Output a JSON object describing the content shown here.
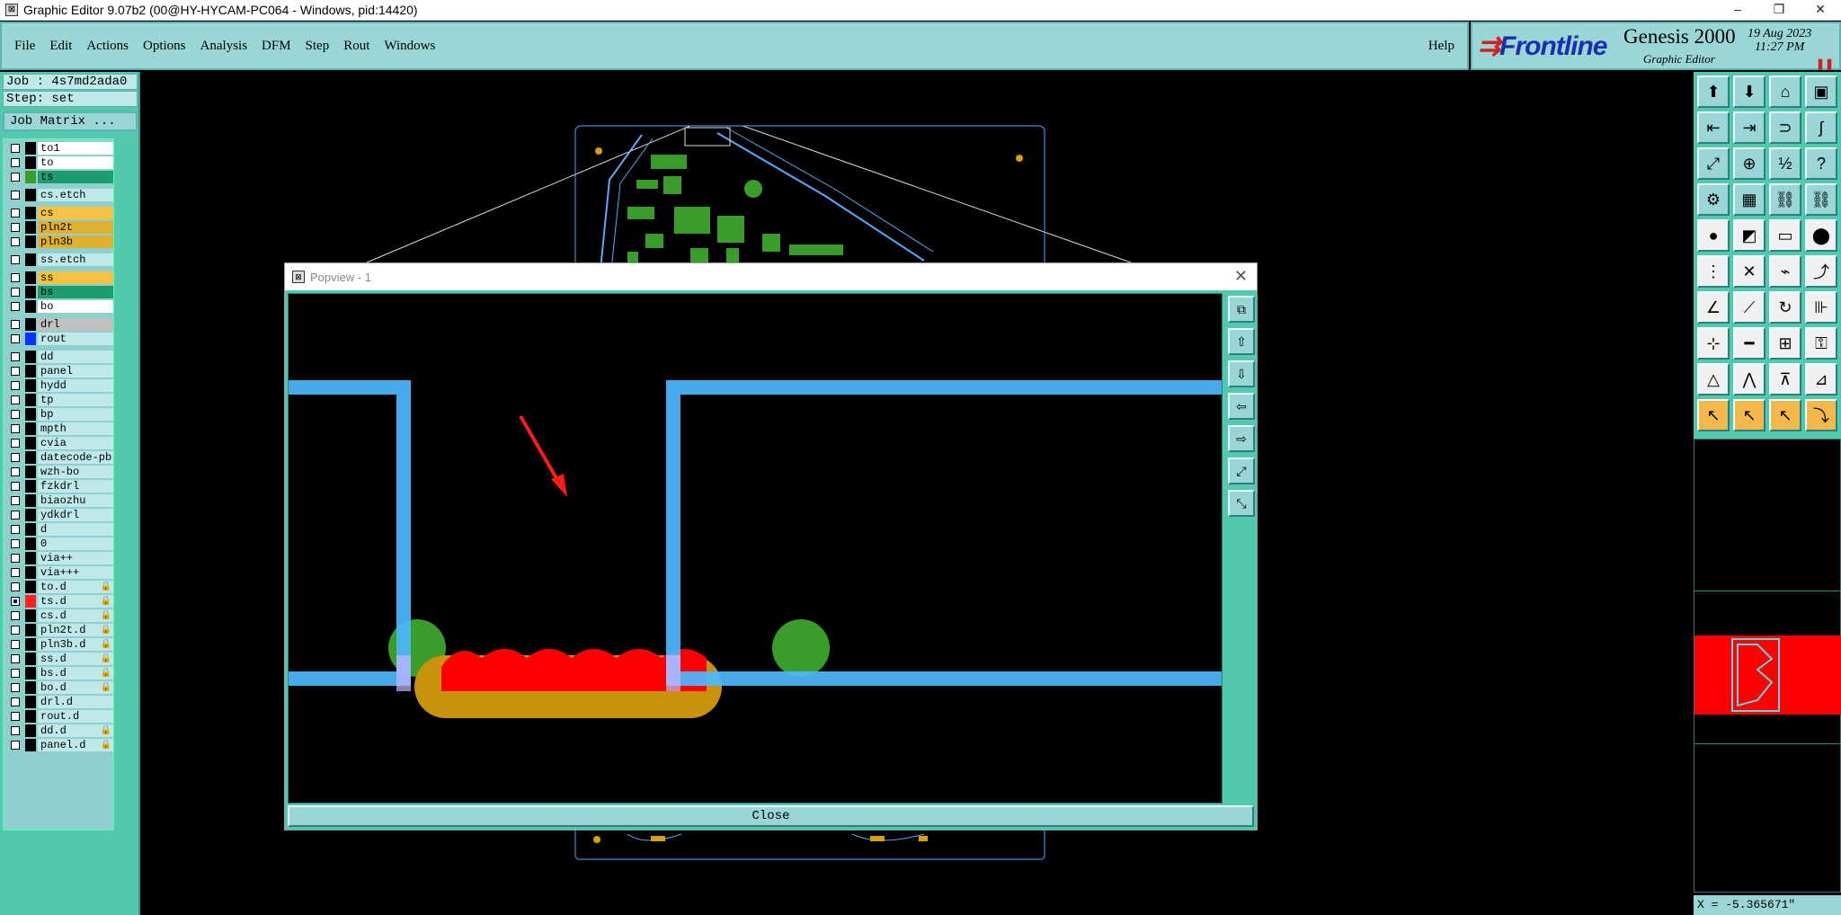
{
  "window": {
    "title": "Graphic Editor 9.07b2 (00@HY-HYCAM-PC064 - Windows, pid:14420)",
    "minimize": "–",
    "restore": "❐",
    "close": "✕"
  },
  "menu": {
    "items": [
      "File",
      "Edit",
      "Actions",
      "Options",
      "Analysis",
      "DFM",
      "Step",
      "Rout",
      "Windows"
    ],
    "help": "Help"
  },
  "brand": {
    "logo": "Frontline",
    "product": "Genesis 2000",
    "subtitle": "Graphic Editor",
    "date": "19 Aug 2023",
    "time": "11:27 PM"
  },
  "left_panel": {
    "job": "Job : 4s7md2ada0",
    "step": "Step: set",
    "job_matrix": "Job Matrix ..."
  },
  "layers": [
    {
      "name": "to1",
      "swatch": "#000000",
      "bg": "#ffffff",
      "gap": false
    },
    {
      "name": "to",
      "swatch": "#000000",
      "bg": "#ffffff",
      "gap": false
    },
    {
      "name": "ts",
      "swatch": "#3a9c2a",
      "bg": "#1c9c6f",
      "gap": false
    },
    {
      "name": "cs.etch",
      "swatch": "#000000",
      "bg": "#bfe8e8",
      "gap": true
    },
    {
      "name": "cs",
      "swatch": "#000000",
      "bg": "#f5c242",
      "gap": true
    },
    {
      "name": "pln2t",
      "swatch": "#000000",
      "bg": "#e0b030",
      "gap": false
    },
    {
      "name": "pln3b",
      "swatch": "#000000",
      "bg": "#e0b030",
      "gap": false
    },
    {
      "name": "ss.etch",
      "swatch": "#000000",
      "bg": "#bfe8e8",
      "gap": true
    },
    {
      "name": "ss",
      "swatch": "#000000",
      "bg": "#f5c242",
      "gap": true
    },
    {
      "name": "bs",
      "swatch": "#000000",
      "bg": "#1c9c6f",
      "gap": false
    },
    {
      "name": "bo",
      "swatch": "#000000",
      "bg": "#ffffff",
      "gap": false
    },
    {
      "name": "drl",
      "swatch": "#000000",
      "bg": "#c0c0c0",
      "gap": true
    },
    {
      "name": "rout",
      "swatch": "#1030ff",
      "bg": "#bfe8e8",
      "gap": false
    },
    {
      "name": "dd",
      "swatch": "#000000",
      "bg": "#bfe8e8",
      "gap": true
    },
    {
      "name": "panel",
      "swatch": "#000000",
      "bg": "#bfe8e8",
      "gap": false
    },
    {
      "name": "hydd",
      "swatch": "#000000",
      "bg": "#bfe8e8",
      "gap": false
    },
    {
      "name": "tp",
      "swatch": "#000000",
      "bg": "#bfe8e8",
      "gap": false
    },
    {
      "name": "bp",
      "swatch": "#000000",
      "bg": "#bfe8e8",
      "gap": false
    },
    {
      "name": "mpth",
      "swatch": "#000000",
      "bg": "#bfe8e8",
      "gap": false
    },
    {
      "name": "cvia",
      "swatch": "#000000",
      "bg": "#bfe8e8",
      "gap": false
    },
    {
      "name": "datecode-pb",
      "swatch": "#000000",
      "bg": "#bfe8e8",
      "gap": false
    },
    {
      "name": "wzh-bo",
      "swatch": "#000000",
      "bg": "#bfe8e8",
      "gap": false
    },
    {
      "name": "fzkdrl",
      "swatch": "#000000",
      "bg": "#bfe8e8",
      "gap": false
    },
    {
      "name": "biaozhu",
      "swatch": "#000000",
      "bg": "#bfe8e8",
      "gap": false
    },
    {
      "name": "ydkdrl",
      "swatch": "#000000",
      "bg": "#bfe8e8",
      "gap": false
    },
    {
      "name": "d",
      "swatch": "#000000",
      "bg": "#bfe8e8",
      "gap": false
    },
    {
      "name": "0",
      "swatch": "#000000",
      "bg": "#bfe8e8",
      "gap": false
    },
    {
      "name": "via++",
      "swatch": "#000000",
      "bg": "#bfe8e8",
      "gap": false
    },
    {
      "name": "via+++",
      "swatch": "#000000",
      "bg": "#bfe8e8",
      "gap": false
    },
    {
      "name": "to.d",
      "swatch": "#000000",
      "bg": "#bfe8e8",
      "gap": false,
      "lock": true
    },
    {
      "name": "ts.d",
      "swatch": "#ff2020",
      "bg": "#bfe8e8",
      "gap": false,
      "lock": true,
      "sel": true
    },
    {
      "name": "cs.d",
      "swatch": "#000000",
      "bg": "#bfe8e8",
      "gap": false,
      "lock": true
    },
    {
      "name": "pln2t.d",
      "swatch": "#000000",
      "bg": "#bfe8e8",
      "gap": false,
      "lock": true
    },
    {
      "name": "pln3b.d",
      "swatch": "#000000",
      "bg": "#bfe8e8",
      "gap": false,
      "lock": true
    },
    {
      "name": "ss.d",
      "swatch": "#000000",
      "bg": "#bfe8e8",
      "gap": false,
      "lock": true
    },
    {
      "name": "bs.d",
      "swatch": "#000000",
      "bg": "#bfe8e8",
      "gap": false,
      "lock": true
    },
    {
      "name": "bo.d",
      "swatch": "#000000",
      "bg": "#bfe8e8",
      "gap": false,
      "lock": true
    },
    {
      "name": "drl.d",
      "swatch": "#000000",
      "bg": "#bfe8e8",
      "gap": false
    },
    {
      "name": "rout.d",
      "swatch": "#000000",
      "bg": "#bfe8e8",
      "gap": false
    },
    {
      "name": "dd.d",
      "swatch": "#000000",
      "bg": "#bfe8e8",
      "gap": false,
      "lock": true
    },
    {
      "name": "panel.d",
      "swatch": "#000000",
      "bg": "#bfe8e8",
      "gap": false,
      "lock": true
    }
  ],
  "popview": {
    "title": "Popview - 1",
    "close_x": "✕",
    "close_button": "Close"
  },
  "status": {
    "coords": "X = -5.365671\""
  },
  "icons": {
    "tool": "toolbox-icon",
    "lock": "lock-icon"
  }
}
